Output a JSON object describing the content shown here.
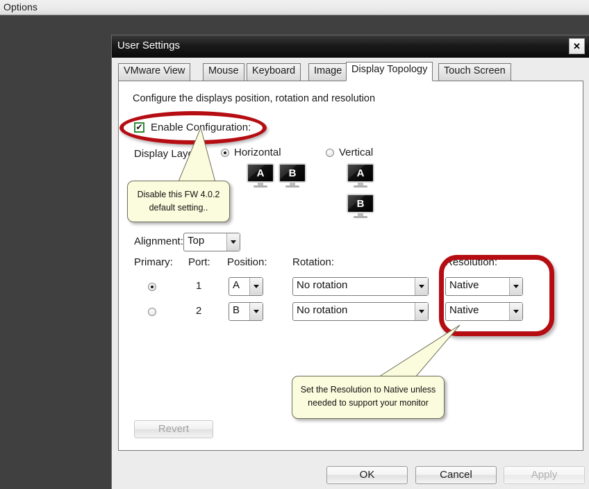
{
  "desktop": {
    "options_bar_label": "Options",
    "background_color": "#404040"
  },
  "dialog": {
    "title": "User Settings",
    "close_icon": "close-icon",
    "close_glyph": "✕",
    "tabs": [
      {
        "label": "VMware View",
        "active": false
      },
      {
        "label": "Mouse",
        "active": false
      },
      {
        "label": "Keyboard",
        "active": false
      },
      {
        "label": "Image",
        "active": false
      },
      {
        "label": "Display Topology",
        "active": true
      },
      {
        "label": "Touch Screen",
        "active": false
      }
    ],
    "footer_buttons": {
      "ok": "OK",
      "cancel": "Cancel",
      "apply": "Apply"
    }
  },
  "panel": {
    "description": "Configure the displays position, rotation and resolution",
    "enable_configuration": {
      "label": "Enable Configuration:",
      "checked": true,
      "check_glyph": "✔",
      "border_color": "#2e8b35"
    },
    "display_layout": {
      "label": "Display Layout:",
      "options": [
        {
          "label": "Horizontal",
          "selected": true
        },
        {
          "label": "Vertical",
          "selected": false
        }
      ],
      "horizontal_monitors": [
        "A",
        "B"
      ],
      "vertical_monitors": [
        "A",
        "B"
      ]
    },
    "alignment": {
      "label": "Alignment:",
      "value": "Top"
    },
    "table": {
      "headers": {
        "primary": "Primary:",
        "port": "Port:",
        "position": "Position:",
        "rotation": "Rotation:",
        "resolution": "Resolution:"
      },
      "rows": [
        {
          "primary_selected": true,
          "port": "1",
          "position": "A",
          "rotation": "No rotation",
          "resolution": "Native"
        },
        {
          "primary_selected": false,
          "port": "2",
          "position": "B",
          "rotation": "No rotation",
          "resolution": "Native"
        }
      ]
    },
    "revert_button": {
      "label": "Revert",
      "enabled": false
    }
  },
  "annotations": {
    "highlight_color": "#b50d12",
    "callouts": [
      {
        "text": "Disable this FW 4.0.2 default setting..",
        "line1": "Disable this FW 4.0.2",
        "line2": "default setting.."
      },
      {
        "text": "Set the Resolution to Native unless needed to support your monitor",
        "line1": "Set the Resolution to Native unless",
        "line2": "needed to support your monitor"
      }
    ]
  }
}
